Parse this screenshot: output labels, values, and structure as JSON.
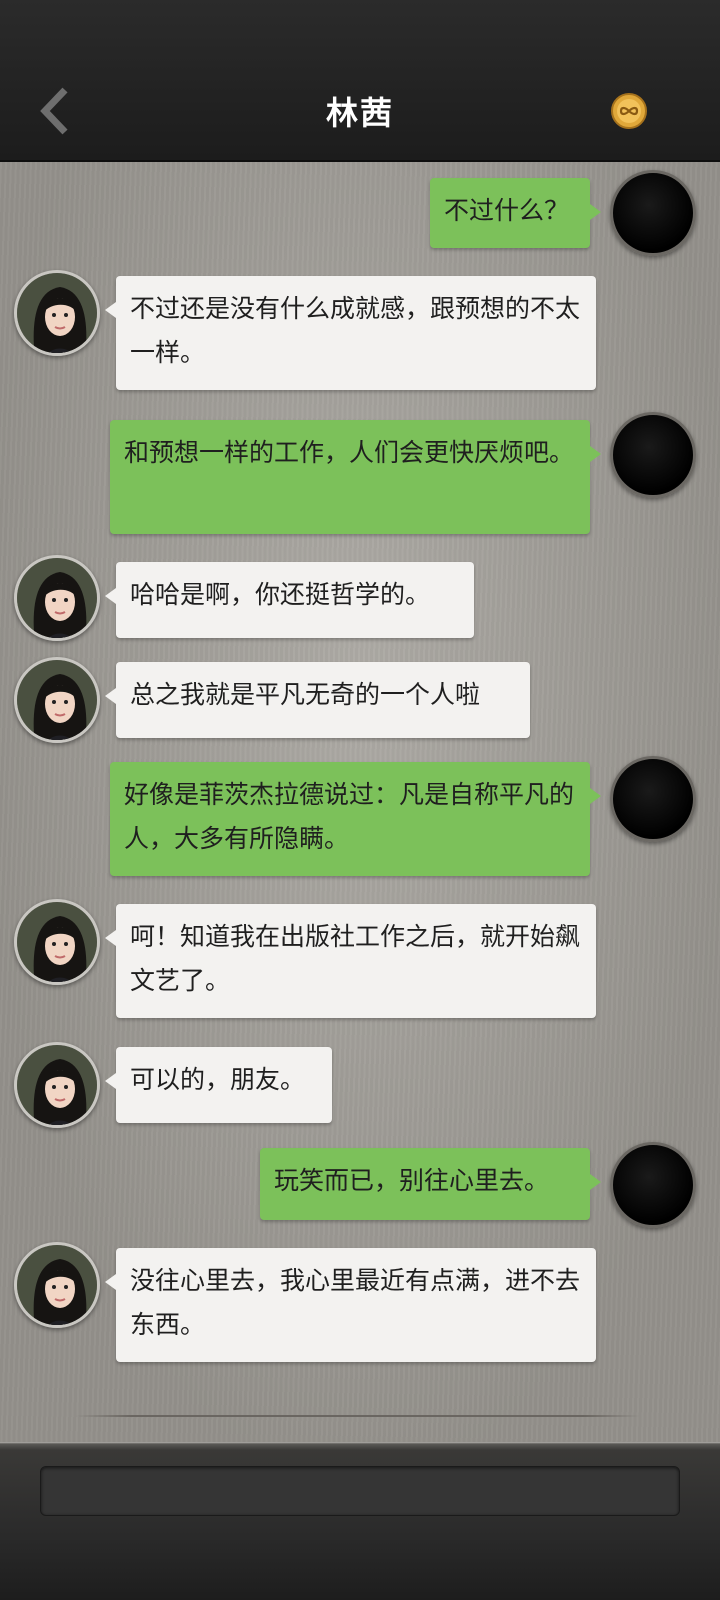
{
  "header": {
    "title": "林茜",
    "back_icon": "chevron-left-icon",
    "coin_icon": "infinity-coin-icon"
  },
  "messages": [
    {
      "side": "out",
      "text": "不过什么？"
    },
    {
      "side": "in",
      "text": "不过还是没有什么成就感，跟预想的不太一样。"
    },
    {
      "side": "out",
      "text": "和预想一样的工作，人们会更快厌烦吧。"
    },
    {
      "side": "in",
      "text": "哈哈是啊，你还挺哲学的。"
    },
    {
      "side": "in",
      "text": "总之我就是平凡无奇的一个人啦"
    },
    {
      "side": "out",
      "text": "好像是菲茨杰拉德说过：凡是自称平凡的人，大多有所隐瞒。"
    },
    {
      "side": "in",
      "text": "呵！知道我在出版社工作之后，就开始飙文艺了。"
    },
    {
      "side": "in",
      "text": "可以的，朋友。"
    },
    {
      "side": "out",
      "text": "玩笑而已，别往心里去。"
    },
    {
      "side": "in",
      "text": "没往心里去，我心里最近有点满，进不去东西。"
    }
  ],
  "colors": {
    "bubble_out": "#7cc15a",
    "bubble_in": "#f3f2f0",
    "header_bg": "#1c1c1c"
  }
}
